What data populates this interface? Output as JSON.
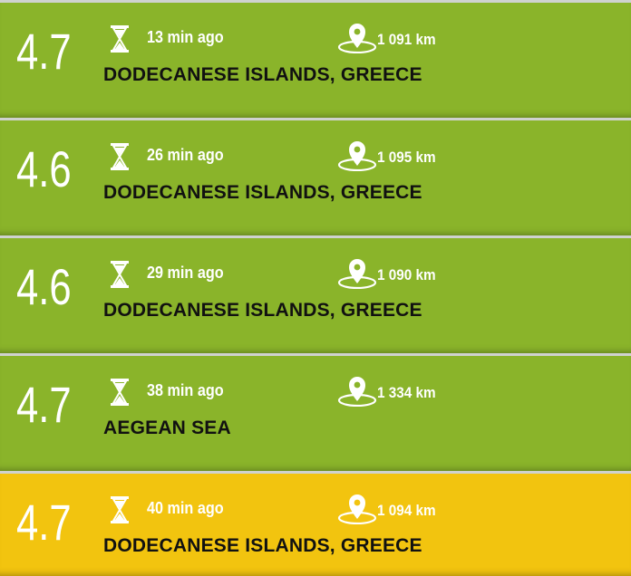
{
  "earthquakes": [
    {
      "magnitude": "4.7",
      "time_ago": "13 min ago",
      "distance": "1 091 km",
      "region": "DODECANESE ISLANDS, GREECE",
      "severity_color": "#8ab42a"
    },
    {
      "magnitude": "4.6",
      "time_ago": "26 min ago",
      "distance": "1 095 km",
      "region": "DODECANESE ISLANDS, GREECE",
      "severity_color": "#8ab42a"
    },
    {
      "magnitude": "4.6",
      "time_ago": "29 min ago",
      "distance": "1 090 km",
      "region": "DODECANESE ISLANDS, GREECE",
      "severity_color": "#8ab42a"
    },
    {
      "magnitude": "4.7",
      "time_ago": "38 min ago",
      "distance": "1 334 km",
      "region": "AEGEAN SEA",
      "severity_color": "#8ab42a"
    },
    {
      "magnitude": "4.7",
      "time_ago": "40 min ago",
      "distance": "1 094 km",
      "region": "DODECANESE ISLANDS, GREECE",
      "severity_color": "#f2c40f"
    }
  ],
  "icons": {
    "time": "hourglass-icon",
    "distance": "location-pin-icon"
  }
}
